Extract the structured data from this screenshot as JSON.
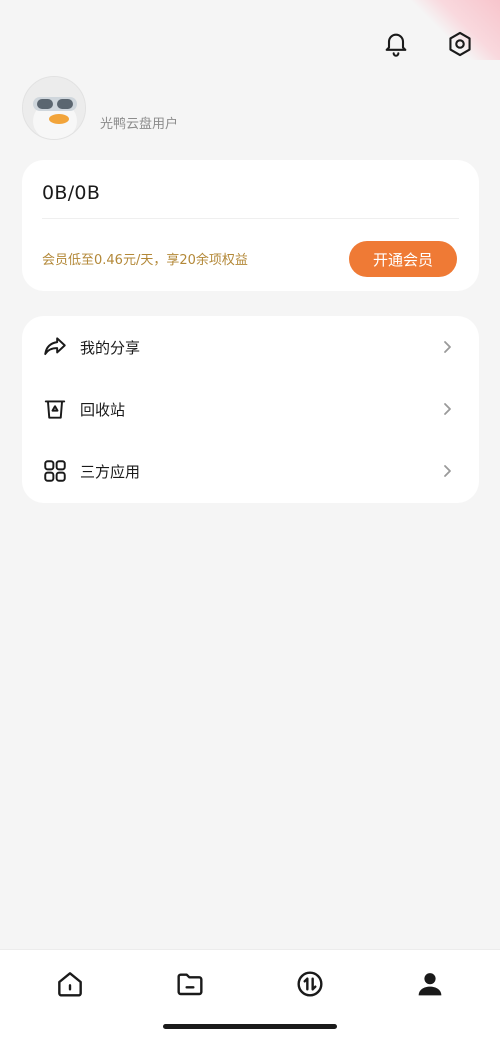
{
  "header": {
    "notification_icon": "bell-icon",
    "settings_icon": "eye-gear-icon"
  },
  "profile": {
    "username": "光鸭云盘用户",
    "avatar_icon": "duck-avatar"
  },
  "storage": {
    "value": "0B/0B",
    "promo_text": "会员低至0.46元/天，享20余项权益",
    "vip_button_label": "开通会员",
    "accent_color": "#ef7a35",
    "promo_color": "#b38838"
  },
  "menu": {
    "items": [
      {
        "label": "我的分享",
        "icon": "share-icon"
      },
      {
        "label": "回收站",
        "icon": "recycle-bin-icon"
      },
      {
        "label": "三方应用",
        "icon": "grid-apps-icon"
      }
    ]
  },
  "tabbar": {
    "tabs": [
      {
        "icon": "home-icon"
      },
      {
        "icon": "folder-icon"
      },
      {
        "icon": "transfer-icon"
      },
      {
        "icon": "profile-icon",
        "active": true
      }
    ]
  }
}
